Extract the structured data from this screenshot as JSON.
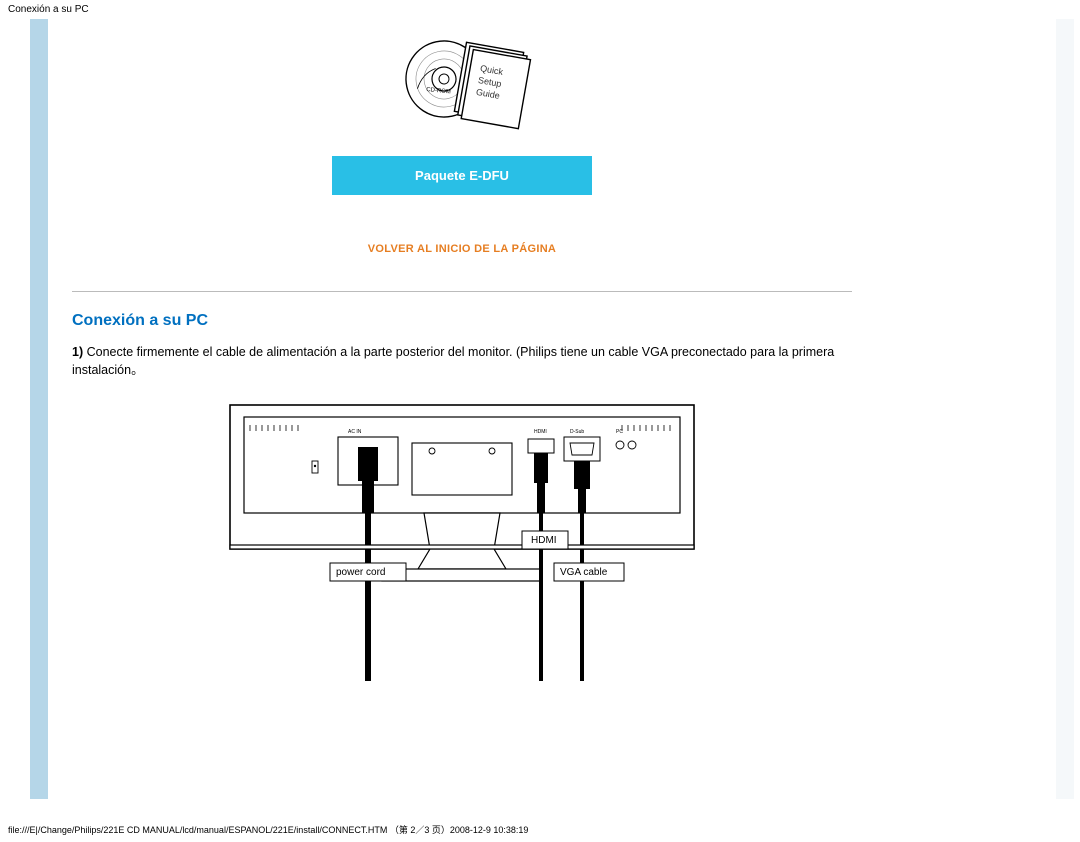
{
  "header": {
    "title": "Conexión a su PC"
  },
  "edfu": {
    "label": "Paquete E-DFU"
  },
  "backToTop": "VOLVER AL INICIO DE LA PÁGINA",
  "section": {
    "title": "Conexión a su PC",
    "step_number": "1)",
    "step_text": " Conecte firmemente el cable de alimentación a la parte posterior del monitor. (Philips tiene un cable VGA preconectado para la primera instalación。"
  },
  "monitor_labels": {
    "power_cord": "power cord",
    "hdmi": "HDMI",
    "vga_cable": "VGA cable"
  },
  "footer": {
    "path": "file:///E|/Change/Philips/221E CD MANUAL/lcd/manual/ESPANOL/221E/install/CONNECT.HTM （第 2／3 页）2008-12-9 10:38:19"
  }
}
